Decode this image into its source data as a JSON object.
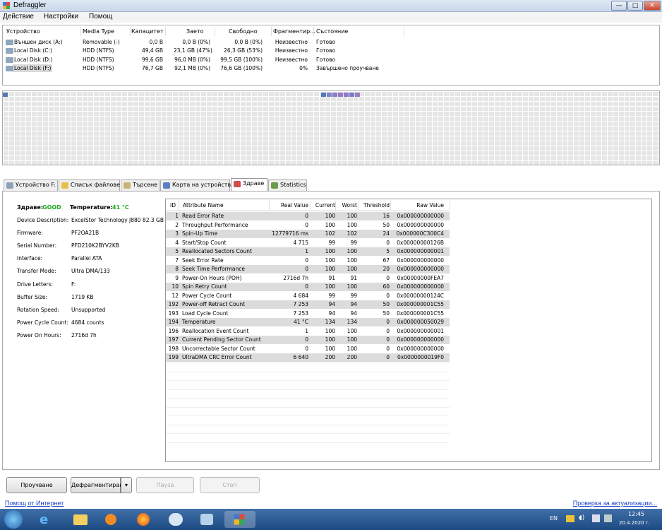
{
  "window": {
    "title": "Defraggler",
    "min": "—",
    "max": "□",
    "close": "✕"
  },
  "menu": [
    "Действие",
    "Настройки",
    "Помощ"
  ],
  "drives": {
    "headers": [
      "Устройство",
      "Media Type",
      "Капацитет",
      "Заето",
      "Свободно",
      "Фрагментир...",
      "Състояние"
    ],
    "rows": [
      [
        "Външен диск (A:)",
        "Removable (-)",
        "0,0 B",
        "0,0 B (0%)",
        "0,0 B (0%)",
        "Неизвестно",
        "Готово"
      ],
      [
        "Local Disk (C:)",
        "HDD (NTFS)",
        "49,4 GB",
        "23,1 GB (47%)",
        "26,3 GB (53%)",
        "Неизвестно",
        "Готово"
      ],
      [
        "Local Disk (D:)",
        "HDD (NTFS)",
        "99,6 GB",
        "96,0 MB (0%)",
        "99,5 GB (100%)",
        "Неизвестно",
        "Готово"
      ],
      [
        "Local Disk (F:)",
        "HDD (NTFS)",
        "76,7 GB",
        "92,1 MB (0%)",
        "76,6 GB (100%)",
        "0%",
        "Завършено проучване"
      ]
    ]
  },
  "tabs": [
    "Устройство F:",
    "Списък файлове",
    "Търсене",
    "Карта на устройство",
    "Здраве",
    "Statistics"
  ],
  "health": {
    "status_label": "Здраве:",
    "status_value": "GOOD",
    "temp_label": "Temperature:",
    "temp_value": "41 °C",
    "fields": [
      [
        "Device Description:",
        "ExcelStor Technology J880 82.3 GB"
      ],
      [
        "Firmware:",
        "PF2OA21B"
      ],
      [
        "Serial Number:",
        "PFD210K2BYV2KB"
      ],
      [
        "Interface:",
        "Parallel ATA"
      ],
      [
        "Transfer Mode:",
        "Ultra DMA/133"
      ],
      [
        "Drive Letters:",
        "F:"
      ],
      [
        "Buffer Size:",
        "1719 KB"
      ],
      [
        "Rotation Speed:",
        "Unsupported"
      ],
      [
        "Power Cycle Count:",
        "4684 counts"
      ],
      [
        "Power On Hours:",
        "2716d 7h"
      ]
    ]
  },
  "smart": {
    "headers": [
      "ID",
      "Attribute Name",
      "Real Value",
      "Current",
      "Worst",
      "Threshold",
      "Raw Value"
    ],
    "rows": [
      [
        "1",
        "Read Error Rate",
        "0",
        "100",
        "100",
        "16",
        "0x000000000000"
      ],
      [
        "2",
        "Throughput Performance",
        "0",
        "100",
        "100",
        "50",
        "0x000000000000"
      ],
      [
        "3",
        "Spin-Up Time",
        "12779716 ms",
        "102",
        "102",
        "24",
        "0x000000C300C4"
      ],
      [
        "4",
        "Start/Stop Count",
        "4 715",
        "99",
        "99",
        "0",
        "0x00000000126B"
      ],
      [
        "5",
        "Reallocated Sectors Count",
        "1",
        "100",
        "100",
        "5",
        "0x000000000001"
      ],
      [
        "7",
        "Seek Error Rate",
        "0",
        "100",
        "100",
        "67",
        "0x000000000000"
      ],
      [
        "8",
        "Seek Time Performance",
        "0",
        "100",
        "100",
        "20",
        "0x000000000000"
      ],
      [
        "9",
        "Power-On Hours (POH)",
        "2716d 7h",
        "91",
        "91",
        "0",
        "0x00000000FEA7"
      ],
      [
        "10",
        "Spin Retry Count",
        "0",
        "100",
        "100",
        "60",
        "0x000000000000"
      ],
      [
        "12",
        "Power Cycle Count",
        "4 684",
        "99",
        "99",
        "0",
        "0x00000000124C"
      ],
      [
        "192",
        "Power-off Retract Count",
        "7 253",
        "94",
        "94",
        "50",
        "0x000000001C55"
      ],
      [
        "193",
        "Load Cycle Count",
        "7 253",
        "94",
        "94",
        "50",
        "0x000000001C55"
      ],
      [
        "194",
        "Temperature",
        "41 °C",
        "134",
        "134",
        "0",
        "0x000000050029"
      ],
      [
        "196",
        "Reallocation Event Count",
        "1",
        "100",
        "100",
        "0",
        "0x000000000001"
      ],
      [
        "197",
        "Current Pending Sector Count",
        "0",
        "100",
        "100",
        "0",
        "0x000000000000"
      ],
      [
        "198",
        "Uncorrectable Sector Count",
        "0",
        "100",
        "100",
        "0",
        "0x000000000000"
      ],
      [
        "199",
        "UltraDMA CRC Error Count",
        "6 640",
        "200",
        "200",
        "0",
        "0x0000000019F0"
      ]
    ]
  },
  "buttons": {
    "analyze": "Проучване",
    "defrag": "Дефрагментиране",
    "pause": "Пауза",
    "stop": "Стоп"
  },
  "footer": {
    "help": "Помощ от Интернет",
    "update": "Проверка за актуализации..."
  },
  "taskbar": {
    "lang": "EN",
    "time": "12:45",
    "date": "20.4.2020 г."
  },
  "colors": {
    "good": "#22aa22",
    "temp": "#22aa22",
    "link": "#1b44c8",
    "map_used": "#6b6bb8"
  }
}
